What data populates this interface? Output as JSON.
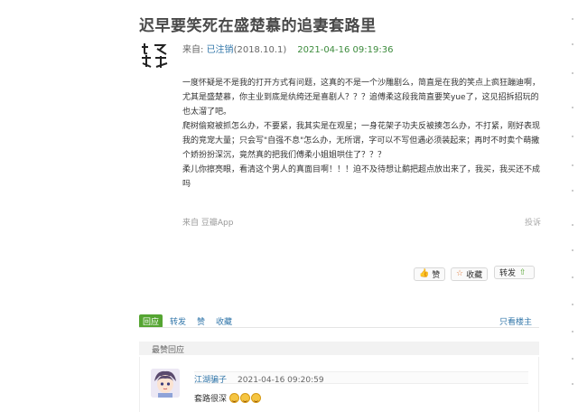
{
  "post": {
    "title": "迟早要笑死在盛楚慕的追妻套路里",
    "from_label": "来自: ",
    "author": "已注销",
    "author_date": "(2018.10.1)",
    "date": "2021-04-16 09:19:36",
    "paragraphs": [
      "一度怀疑是不是我的打开方式有问题，这真的不是一个沙雕剧么，简直是在我的笑点上疯狂蹦迪啊，尤其是盛楚慕，你主业到底是纨绔还是喜剧人？？？追傅柔这段我简直要笑yue了，这见招拆招玩的也太溜了吧。",
      "爬树偷窥被抓怎么办，不要紧，我其实是在观星；一身花架子功夫反被揍怎么办，不打紧，刚好表现我的竞宠大量；只会写\"自强不息\"怎么办，无所谓，字可以不写但遇必须装起来；再时不时卖个萌撒个娇扮扮深沉，竟然真的把我们傅柔小姐姐哄住了？？？",
      "柔儿你擦亮眼，看清这个男人的真面目啊！！！迫不及待想让鹬把超点放出来了，我买，我买还不成吗"
    ],
    "source": "来自 豆瓣App",
    "report": "投诉"
  },
  "actions": {
    "like_label": "赞",
    "collect_label": "收藏",
    "share_label": "转发"
  },
  "tabs": {
    "reply_label": "回应",
    "share_label": "转发",
    "like_label": "赞",
    "collect_label": "收藏",
    "owner_only_label": "只看楼主"
  },
  "best_reply": {
    "header": "最赞回应",
    "user": "江湖骗子",
    "time": "2021-04-16 09:20:59",
    "text": "套路很深"
  }
}
